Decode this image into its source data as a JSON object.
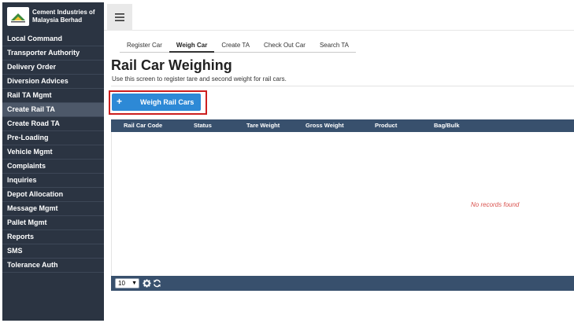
{
  "brand": {
    "name_line1": "Cement Industries of",
    "name_line2": "Malaysia Berhad",
    "logo_icon": "company-logo"
  },
  "sidebar": {
    "items": [
      {
        "label": "Local Command"
      },
      {
        "label": "Transporter Authority"
      },
      {
        "label": "Delivery Order"
      },
      {
        "label": "Diversion Advices"
      },
      {
        "label": "Rail TA Mgmt"
      },
      {
        "label": "Create Rail TA",
        "active": true
      },
      {
        "label": "Create Road TA"
      },
      {
        "label": "Pre-Loading"
      },
      {
        "label": "Vehicle Mgmt"
      },
      {
        "label": "Complaints"
      },
      {
        "label": "Inquiries"
      },
      {
        "label": "Depot Allocation"
      },
      {
        "label": "Message Mgmt"
      },
      {
        "label": "Pallet Mgmt"
      },
      {
        "label": "Reports"
      },
      {
        "label": "SMS"
      },
      {
        "label": "Tolerance Auth"
      }
    ]
  },
  "topbar": {
    "menu_icon": "hamburger-menu-icon"
  },
  "tabs": [
    {
      "label": "Register Car"
    },
    {
      "label": "Weigh Car",
      "active": true
    },
    {
      "label": "Create TA"
    },
    {
      "label": "Check Out Car"
    },
    {
      "label": "Search TA"
    }
  ],
  "page": {
    "title": "Rail Car Weighing",
    "subtitle": "Use this screen to register tare and second weight for rail cars."
  },
  "actions": {
    "weigh_icon": "+",
    "weigh_label": "Weigh Rail Cars"
  },
  "table": {
    "columns": [
      "Rail Car Code",
      "Status",
      "Tare Weight",
      "Gross Weight",
      "Product",
      "Bag/Bulk"
    ],
    "rows": [],
    "empty_message": "No records found"
  },
  "footer": {
    "page_size": "10",
    "icons": [
      "settings-gear-icon",
      "refresh-icon"
    ]
  },
  "colors": {
    "sidebar_bg": "#2b3442",
    "table_header_bg": "#38506d",
    "primary_button": "#2d89d6",
    "highlight_border": "#cc1f1f",
    "empty_text": "#d9534f"
  }
}
